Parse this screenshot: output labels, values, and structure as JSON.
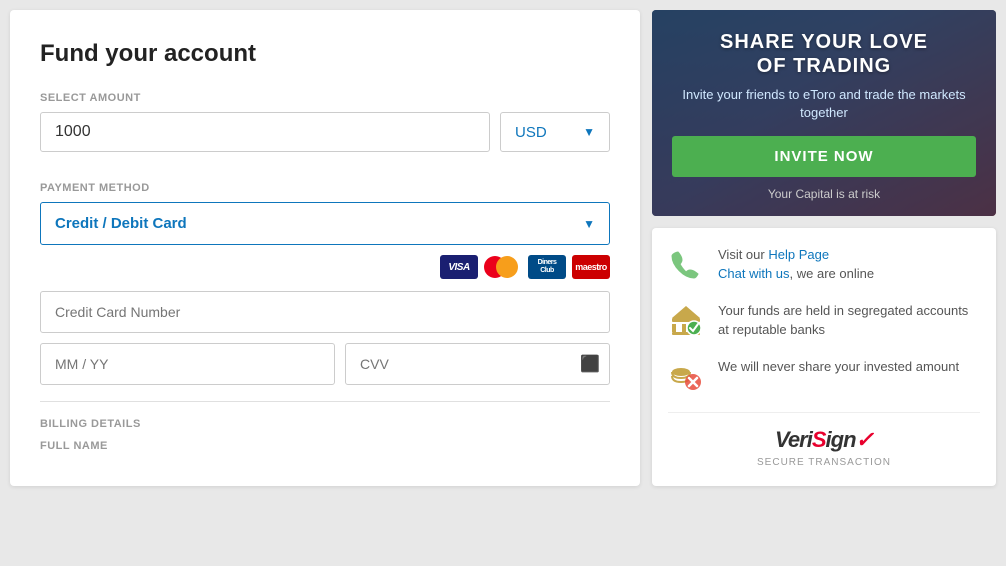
{
  "page": {
    "title": "Fund your account"
  },
  "form": {
    "select_amount_label": "SELECT AMOUNT",
    "amount_value": "1000",
    "currency_value": "USD",
    "payment_method_label": "PAYMENT METHOD",
    "payment_method_selected": "Credit / Debit Card",
    "credit_card_placeholder": "Credit Card Number",
    "mm_yy_placeholder": "MM / YY",
    "cvv_placeholder": "CVV"
  },
  "billing": {
    "label": "BILLING DETAILS",
    "full_name_label": "FULL NAME"
  },
  "banner": {
    "title_line1": "SHARE YOUR LOVE",
    "title_line2": "OF TRADING",
    "subtitle": "Invite your friends to eToro and trade the markets together",
    "invite_btn": "INVITE NOW",
    "risk_text": "Your Capital is at risk"
  },
  "info": {
    "item1_text": "Visit our ",
    "item1_link1": "Help Page",
    "item1_mid": "\nChat with us",
    "item1_link2": "Chat with us",
    "item1_end": ", we are online",
    "item2_text": "Your funds are held in segregated accounts at reputable banks",
    "item3_text": "We will never share your invested amount",
    "verisign_label": "SECURE TRANSACTION"
  }
}
